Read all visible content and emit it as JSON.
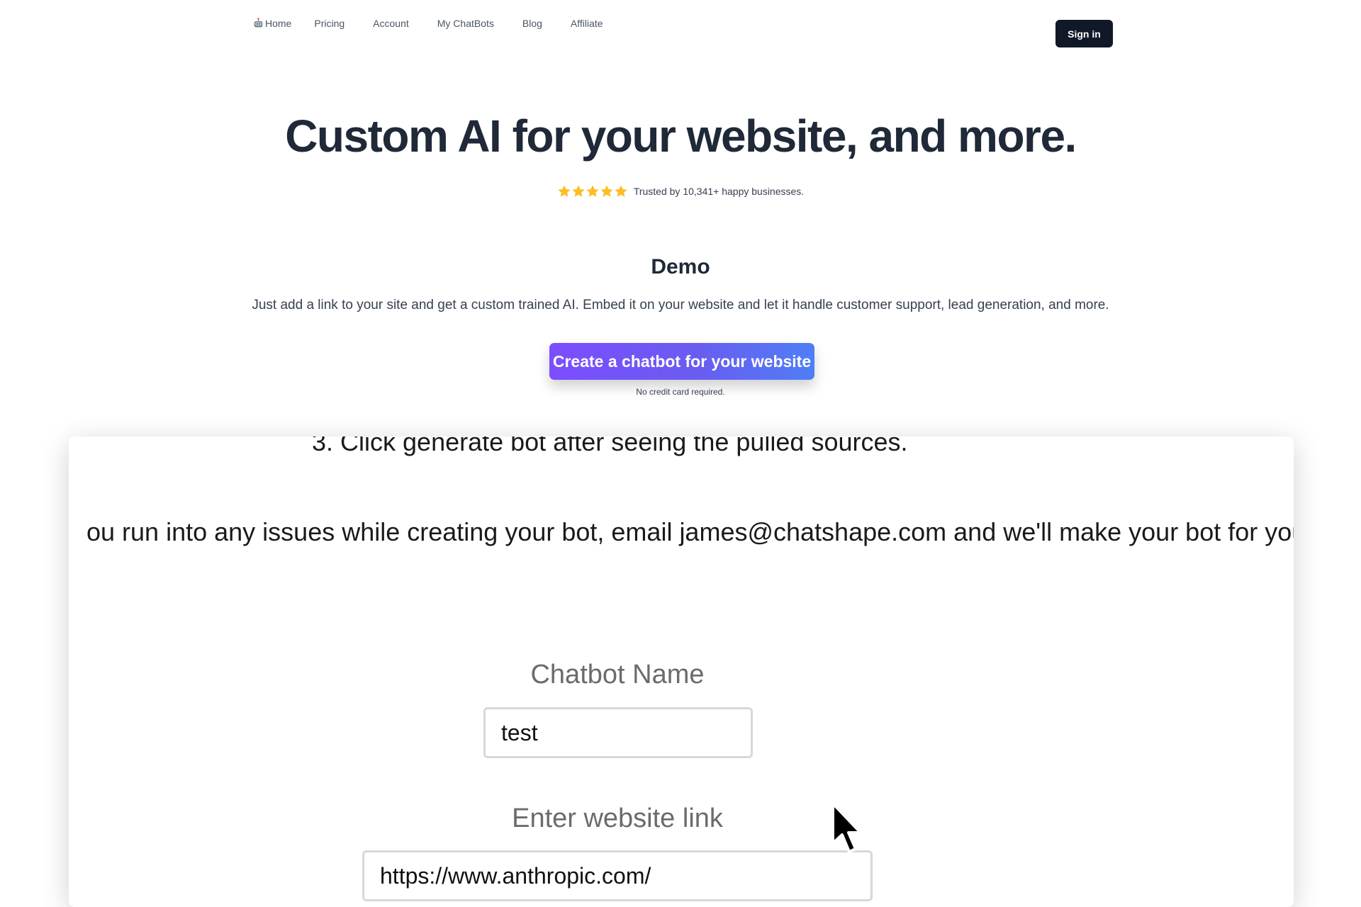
{
  "nav": {
    "items": [
      {
        "label": "Home",
        "icon": "robot-icon"
      },
      {
        "label": "Pricing"
      },
      {
        "label": "Account"
      },
      {
        "label": "My ChatBots"
      },
      {
        "label": "Blog"
      },
      {
        "label": "Affiliate"
      }
    ],
    "signin_label": "Sign in"
  },
  "hero": {
    "title": "Custom AI for your website, and more.",
    "rating_stars": 5,
    "rating_text": "Trusted by 10,341+ happy businesses."
  },
  "demo": {
    "title": "Demo",
    "description": "Just add a link to your site and get a custom trained AI. Embed it on your website and let it handle customer support, lead generation, and more.",
    "cta_label": "Create a chatbot for your website",
    "cta_note": "No credit card required."
  },
  "video": {
    "step_text": "3. Click generate bot after seeing the pulled sources.",
    "issue_text": "ou run into any issues while creating your bot, email james@chatshape.com and we'll make your bot for you!",
    "name_label": "Chatbot Name",
    "name_value": "test",
    "link_label": "Enter website link",
    "link_value": "https://www.anthropic.com/"
  },
  "colors": {
    "star": "#fbbf24",
    "signin_bg": "#111827",
    "cta_start": "#7c4dff",
    "cta_end": "#4f7ef7"
  }
}
